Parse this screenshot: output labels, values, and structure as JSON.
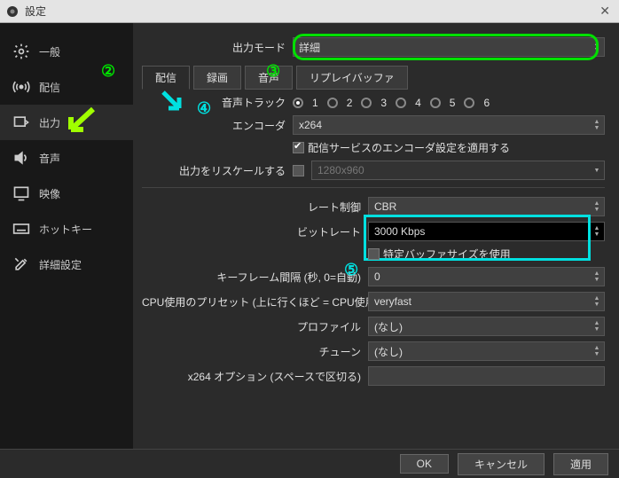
{
  "window": {
    "title": "設定"
  },
  "sidebar": {
    "items": [
      {
        "label": "一般"
      },
      {
        "label": "配信"
      },
      {
        "label": "出力"
      },
      {
        "label": "音声"
      },
      {
        "label": "映像"
      },
      {
        "label": "ホットキー"
      },
      {
        "label": "詳細設定"
      }
    ]
  },
  "output_mode": {
    "label": "出力モード",
    "value": "詳細"
  },
  "tabs": [
    {
      "label": "配信"
    },
    {
      "label": "録画"
    },
    {
      "label": "音声"
    },
    {
      "label": "リプレイバッファ"
    }
  ],
  "audio_track": {
    "label": "音声トラック",
    "options": [
      "1",
      "2",
      "3",
      "4",
      "5",
      "6"
    ],
    "selected": 0
  },
  "encoder": {
    "label": "エンコーダ",
    "value": "x264"
  },
  "enforce": {
    "label": "配信サービスのエンコーダ設定を適用する",
    "checked": true
  },
  "rescale": {
    "label": "出力をリスケールする",
    "checked": false,
    "value": "1280x960"
  },
  "rate_control": {
    "label": "レート制御",
    "value": "CBR"
  },
  "bitrate": {
    "label": "ビットレート",
    "value": "3000 Kbps"
  },
  "custom_buffer": {
    "label": "特定バッファサイズを使用",
    "checked": false
  },
  "keyframe": {
    "label": "キーフレーム間隔 (秒, 0=自動)",
    "value": "0"
  },
  "cpu_preset": {
    "label": "CPU使用のプリセット (上に行くほど = CPU使用低い)",
    "value": "veryfast"
  },
  "profile": {
    "label": "プロファイル",
    "value": "(なし)"
  },
  "tune": {
    "label": "チューン",
    "value": "(なし)"
  },
  "x264opts": {
    "label": "x264 オプション (スペースで区切る)",
    "value": ""
  },
  "footer": {
    "ok": "OK",
    "cancel": "キャンセル",
    "apply": "適用"
  },
  "annotations": {
    "n2": "②",
    "n3": "③",
    "n4": "④",
    "n5": "⑤"
  }
}
